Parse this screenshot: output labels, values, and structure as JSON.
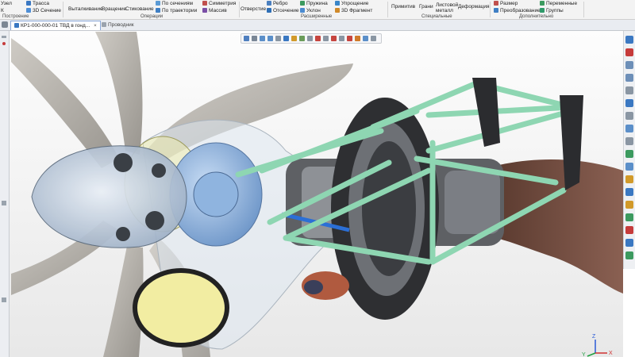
{
  "ribbon": {
    "items": {
      "uzel": "Узел",
      "k": "К",
      "trassa": "Трасса",
      "sechenie3d": "3D Сечение",
      "vytalkivanie": "Выталкивание",
      "vrashchenie": "Вращение",
      "stikovanie": "Стикование",
      "po_secheniyam": "По сечениям",
      "po_traektorii": "По траектории",
      "simmetriya": "Симметрия",
      "massiv": "Массив",
      "otverstie": "Отверстие",
      "rebro": "Ребро",
      "otsechenie": "Отсечение",
      "pruzhina": "Пружина",
      "uklon": "Уклон",
      "uproshchenie": "Упрощение",
      "fragment3d": "3D Фрагмент",
      "primitiv": "Примитив",
      "grani": "Грани",
      "listovoy": "Листовой",
      "metall": "металл",
      "deformatsiya": "Деформация",
      "razmer": "Размер",
      "preobrazovanie": "Преобразование",
      "peremennye": "Переменные",
      "gruppy": "Группы"
    },
    "groups": {
      "postroenie": "Построение",
      "operatsii": "Операции",
      "rasshirennye": "Расширенные",
      "spetsialnye": "Специальные",
      "dopolnitelno": "Дополнительно"
    }
  },
  "tabs": {
    "document": "КР1-000-000-01 ТВД в гонд...",
    "close": "×",
    "explorer": "Проводник"
  },
  "viewport": {
    "triad": {
      "x": "X",
      "y": "Y",
      "z": "Z"
    }
  },
  "colors": {
    "tube": "#8ed6b2",
    "frame": "#3a3a3a",
    "gearbox_blue": "#8fb4df",
    "spinner": "#cdd8e6",
    "intake_yellow": "#f2eda2",
    "exhaust": "#6f4b3e",
    "blade": "#ada9a2"
  },
  "icons": {
    "ribbon": [
      "trassa-icon",
      "sechenie-icon",
      "vytalkivanie-icon",
      "vrashchenie-icon",
      "stikovanie-icon",
      "po-secheniyam-icon",
      "po-traektorii-icon",
      "simmetriya-icon",
      "massiv-icon",
      "otverstie-icon",
      "rebro-icon",
      "otsechenie-icon",
      "pruzhina-icon",
      "uklon-icon",
      "uproshchenie-icon",
      "fragment-icon",
      "primitiv-icon",
      "grani-icon",
      "listovoy-icon",
      "deformatsiya-icon",
      "razmer-icon",
      "preobrazovanie-icon",
      "peremennye-icon",
      "gruppy-icon"
    ],
    "right_toolbar": [
      "table-icon",
      "magnet-icon",
      "zoom-in-icon",
      "zoom-out-icon",
      "pan-icon",
      "rotate-icon",
      "measure-icon",
      "curve-icon",
      "line-icon",
      "layer-icon",
      "sketch-icon",
      "cube-icon",
      "sphere-icon",
      "mate-icon",
      "style-icon",
      "arrow-icon",
      "export-icon",
      "display-icon",
      "settings-icon",
      "material-icon"
    ]
  }
}
